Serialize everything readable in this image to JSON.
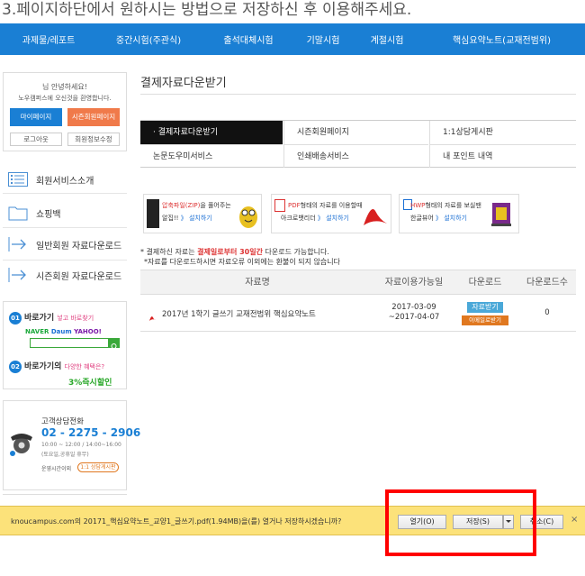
{
  "instruction": "3.페이지하단에서 원하시는 방법으로 저장하신 후 이용해주세요.",
  "topnav": [
    "과제물/레포트",
    "중간시험(주관식)",
    "출석대체시험",
    "기말시험",
    "계절시험",
    "핵심요약노트(교재전범위)"
  ],
  "login": {
    "greet1": "님 안녕하세요!",
    "greet2": "노우캠퍼스에 오신것을 환영합니다.",
    "my_page": "마이페이지",
    "season_page": "시즌회원페이지",
    "logout": "로그아웃",
    "edit_info": "회원정보수정"
  },
  "side_menu": [
    "회원서비스소개",
    "쇼핑백",
    "일반회원 자료다운로드",
    "시즌회원 자료다운로드"
  ],
  "promo": {
    "line1_prefix": "바로가기",
    "line1_suffix": "넣고 바로찾기",
    "line2_prefix": "바로가기의",
    "line2_suffix": "다양한 혜택은?",
    "discount": "3%즉시할인",
    "naver": "NAVER",
    "daum": "Daum",
    "yahoo": "YAHOO!",
    "search_icon": "search-icon"
  },
  "cs": {
    "title": "고객상담전화",
    "phone": "02 - 2275 - 2906",
    "hours": "10:00 ~ 12:00 / 14:00~16:00",
    "hours_note": "(토요일,공휴일 휴무)",
    "off_hours": "운영시간이외",
    "board": "1:1 상담게시판"
  },
  "main": {
    "title": "결제자료다운받기",
    "tabs": [
      "결제자료다운받기",
      "시즌회원페이지",
      "1:1상담게시판",
      "논문도우미서비스",
      "인쇄배송서비스",
      "내 포인트 내역"
    ],
    "info1": {
      "line1_red": "압축파일(ZIP)",
      "line1_rest": "을 풀어주는",
      "line2": "알집!!",
      "link": "》 설치하기"
    },
    "info2": {
      "line1_red": "PDF",
      "line1_rest": "형태의 자료를 이용할때",
      "line2": "아크로뱃리더",
      "link": "》 설치하기"
    },
    "info3": {
      "line1_red": "HWP",
      "line1_rest": "형태의 자료를 보실땐",
      "line2": "한글뷰어",
      "link": "》 설치하기"
    },
    "notice1_prefix": "* 결제하신 자료는",
    "notice1_red": "결제일로부터 30일간",
    "notice1_suffix": "다운로드 가능합니다.",
    "notice2": "*자료를 다운로드하시면 자료오류 이외에는 환불이 되지 않습니다",
    "table": {
      "headers": [
        "자료명",
        "자료이용가능일",
        "다운로드",
        "다운로드수"
      ],
      "rows": [
        {
          "name": "2017년 1학기 글쓰기 교재전범위 핵심요약노트",
          "date_from": "2017-03-09",
          "date_to": "~2017-04-07",
          "download_btn": "자료받기",
          "mail_btn": "이메일로받기",
          "count": "0"
        }
      ]
    }
  },
  "download_bar": {
    "site": "knoucampus.com",
    "message_mid": "의",
    "filename": "20171_핵심요약노트_교양1_글쓰기.pdf",
    "size": "(1.94MB)",
    "message_end": "을(를) 열거나 저장하시겠습니까?",
    "open": "열기(O)",
    "save": "저장(S)",
    "cancel": "취소(C)",
    "close": "×"
  }
}
